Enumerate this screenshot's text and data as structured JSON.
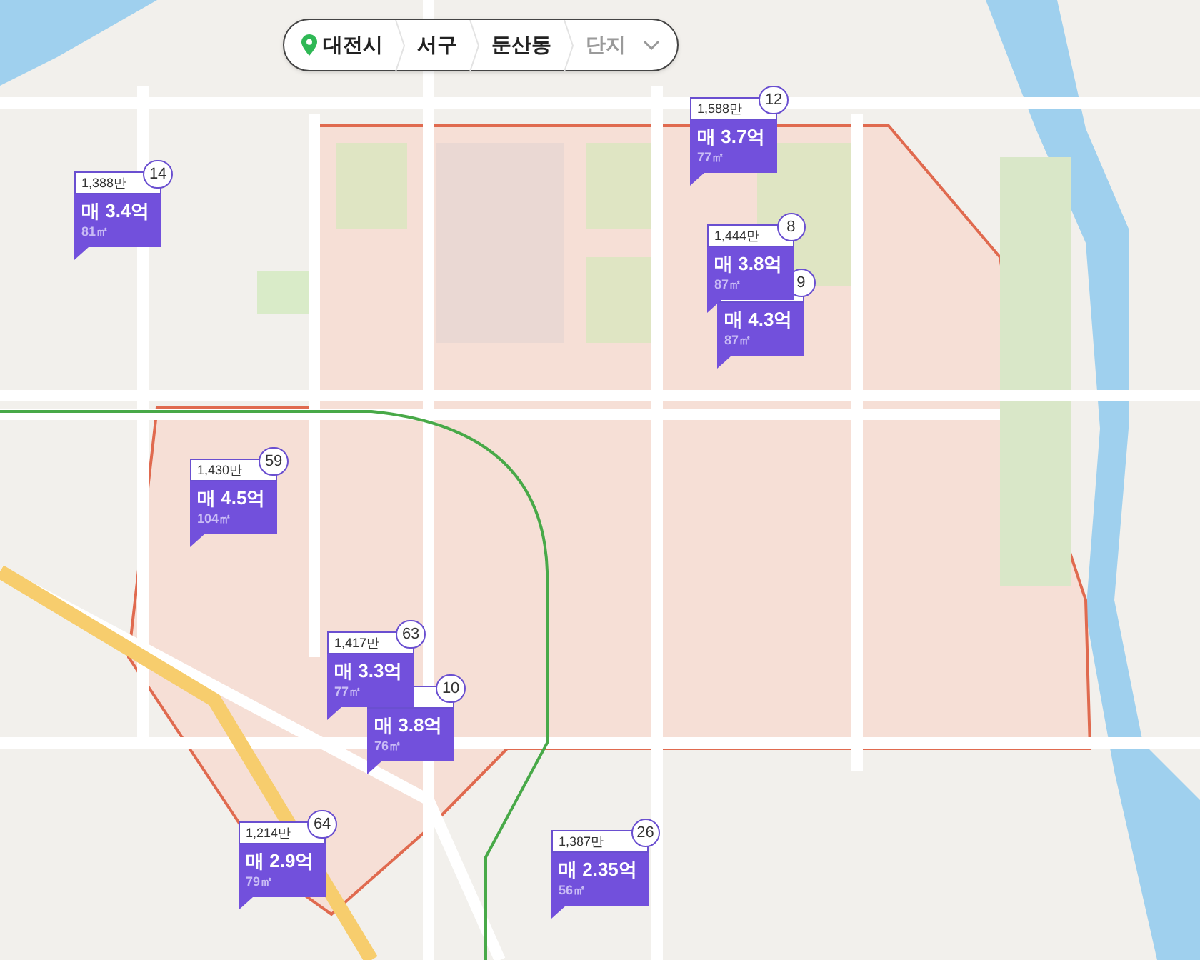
{
  "breadcrumb": [
    {
      "label": "대전시",
      "kind": "location",
      "selected": false
    },
    {
      "label": "서구",
      "kind": "level",
      "selected": false
    },
    {
      "label": "둔산동",
      "kind": "level",
      "selected": false
    },
    {
      "label": "단지",
      "kind": "dropdown",
      "selected": false
    }
  ],
  "markers": [
    {
      "price_per_area": "1,588만",
      "count": "12",
      "price": "매 3.7억",
      "area": "77㎡"
    },
    {
      "price_per_area": "1,388만",
      "count": "14",
      "price": "매 3.4억",
      "area": "81㎡"
    },
    {
      "price_per_area": "1,444만",
      "count": "8",
      "price": "매 3.8억",
      "area": "87㎡"
    },
    {
      "count": "9",
      "price": "매 4.3억",
      "area": "87㎡"
    },
    {
      "price_per_area": "1,430만",
      "count": "59",
      "price": "매 4.5억",
      "area": "104㎡"
    },
    {
      "price_per_area": "1,417만",
      "count": "63",
      "price": "매 3.3억",
      "area": "77㎡"
    },
    {
      "count": "10",
      "price": "매 3.8억",
      "area": "76㎡"
    },
    {
      "price_per_area": "1,214만",
      "count": "64",
      "price": "매 2.9억",
      "area": "79㎡"
    },
    {
      "price_per_area": "1,387만",
      "count": "26",
      "price": "매 2.35억",
      "area": "56㎡"
    }
  ]
}
